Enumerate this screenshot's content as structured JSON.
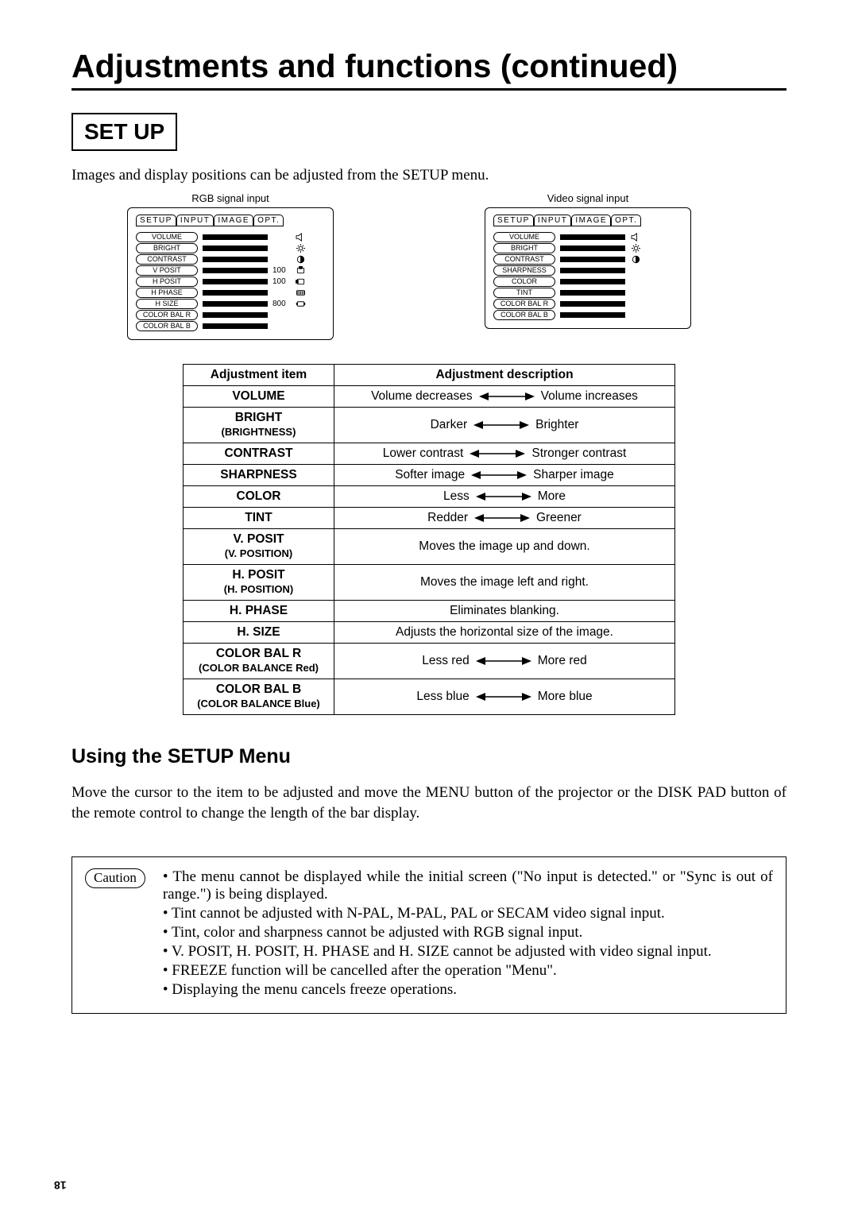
{
  "title": "Adjustments and functions (continued)",
  "setup_heading": "SET UP",
  "intro": "Images and display positions can be adjusted from the SETUP menu.",
  "rgb": {
    "caption": "RGB signal input",
    "tabs": [
      "SETUP",
      "INPUT",
      "IMAGE",
      "OPT."
    ],
    "rows": [
      {
        "label": "VOLUME",
        "num": "",
        "icon": "speaker"
      },
      {
        "label": "BRIGHT",
        "num": "",
        "icon": "sun"
      },
      {
        "label": "CONTRAST",
        "num": "",
        "icon": "contrast"
      },
      {
        "label": "V POSIT",
        "num": "100",
        "icon": "vpos"
      },
      {
        "label": "H POSIT",
        "num": "100",
        "icon": "hpos"
      },
      {
        "label": "H PHASE",
        "num": "",
        "icon": "phase"
      },
      {
        "label": "H SIZE",
        "num": "800",
        "icon": "hsize"
      },
      {
        "label": "COLOR BAL R",
        "num": "",
        "icon": ""
      },
      {
        "label": "COLOR BAL B",
        "num": "",
        "icon": ""
      }
    ]
  },
  "video": {
    "caption": "Video signal input",
    "tabs": [
      "SETUP",
      "INPUT",
      "IMAGE",
      "OPT."
    ],
    "rows": [
      {
        "label": "VOLUME",
        "icon": "speaker"
      },
      {
        "label": "BRIGHT",
        "icon": "sun"
      },
      {
        "label": "CONTRAST",
        "icon": "contrast"
      },
      {
        "label": "SHARPNESS",
        "icon": ""
      },
      {
        "label": "COLOR",
        "icon": ""
      },
      {
        "label": "TINT",
        "icon": ""
      },
      {
        "label": "COLOR BAL R",
        "icon": ""
      },
      {
        "label": "COLOR BAL B",
        "icon": ""
      }
    ]
  },
  "adj": {
    "headers": [
      "Adjustment item",
      "Adjustment description"
    ],
    "rows": [
      {
        "item": "VOLUME",
        "sub": "",
        "left": "Volume decreases",
        "right": "Volume increases",
        "arrow": true
      },
      {
        "item": "BRIGHT",
        "sub": "(BRIGHTNESS)",
        "left": "Darker",
        "right": "Brighter",
        "arrow": true
      },
      {
        "item": "CONTRAST",
        "sub": "",
        "left": "Lower contrast",
        "right": "Stronger contrast",
        "arrow": true
      },
      {
        "item": "SHARPNESS",
        "sub": "",
        "left": "Softer image",
        "right": "Sharper image",
        "arrow": true
      },
      {
        "item": "COLOR",
        "sub": "",
        "left": "Less",
        "right": "More",
        "arrow": true
      },
      {
        "item": "TINT",
        "sub": "",
        "left": "Redder",
        "right": "Greener",
        "arrow": true
      },
      {
        "item": "V. POSIT",
        "sub": "(V. POSITION)",
        "plain": "Moves the image up and down."
      },
      {
        "item": "H. POSIT",
        "sub": "(H. POSITION)",
        "plain": "Moves the image left and right."
      },
      {
        "item": "H. PHASE",
        "sub": "",
        "plain": "Eliminates blanking."
      },
      {
        "item": "H. SIZE",
        "sub": "",
        "plain": "Adjusts the horizontal size of the image."
      },
      {
        "item": "COLOR BAL R",
        "sub": "(COLOR BALANCE Red)",
        "left": "Less  red",
        "right": "More  red",
        "arrow": true
      },
      {
        "item": "COLOR BAL B",
        "sub": "(COLOR BALANCE Blue)",
        "left": "Less  blue",
        "right": "More blue",
        "arrow": true
      }
    ]
  },
  "using_h2": "Using the SETUP Menu",
  "using_para": "Move the cursor to the item to be adjusted and move the MENU button of the projector or the DISK PAD button of the remote control to change the length of the bar display.",
  "caution": {
    "label": "Caution",
    "items": [
      "• The menu cannot be displayed while the initial screen (\"No input is detected.\" or \"Sync is out of range.\") is being displayed.",
      "• Tint cannot be adjusted with N-PAL, M-PAL, PAL or SECAM video signal input.",
      "• Tint, color and sharpness cannot be adjusted with RGB signal input.",
      "• V. POSIT, H. POSIT, H. PHASE and H. SIZE cannot be adjusted with video signal input.",
      "• FREEZE function will be cancelled after the operation \"Menu\".",
      "• Displaying the menu cancels freeze operations."
    ]
  },
  "page_number": "18"
}
